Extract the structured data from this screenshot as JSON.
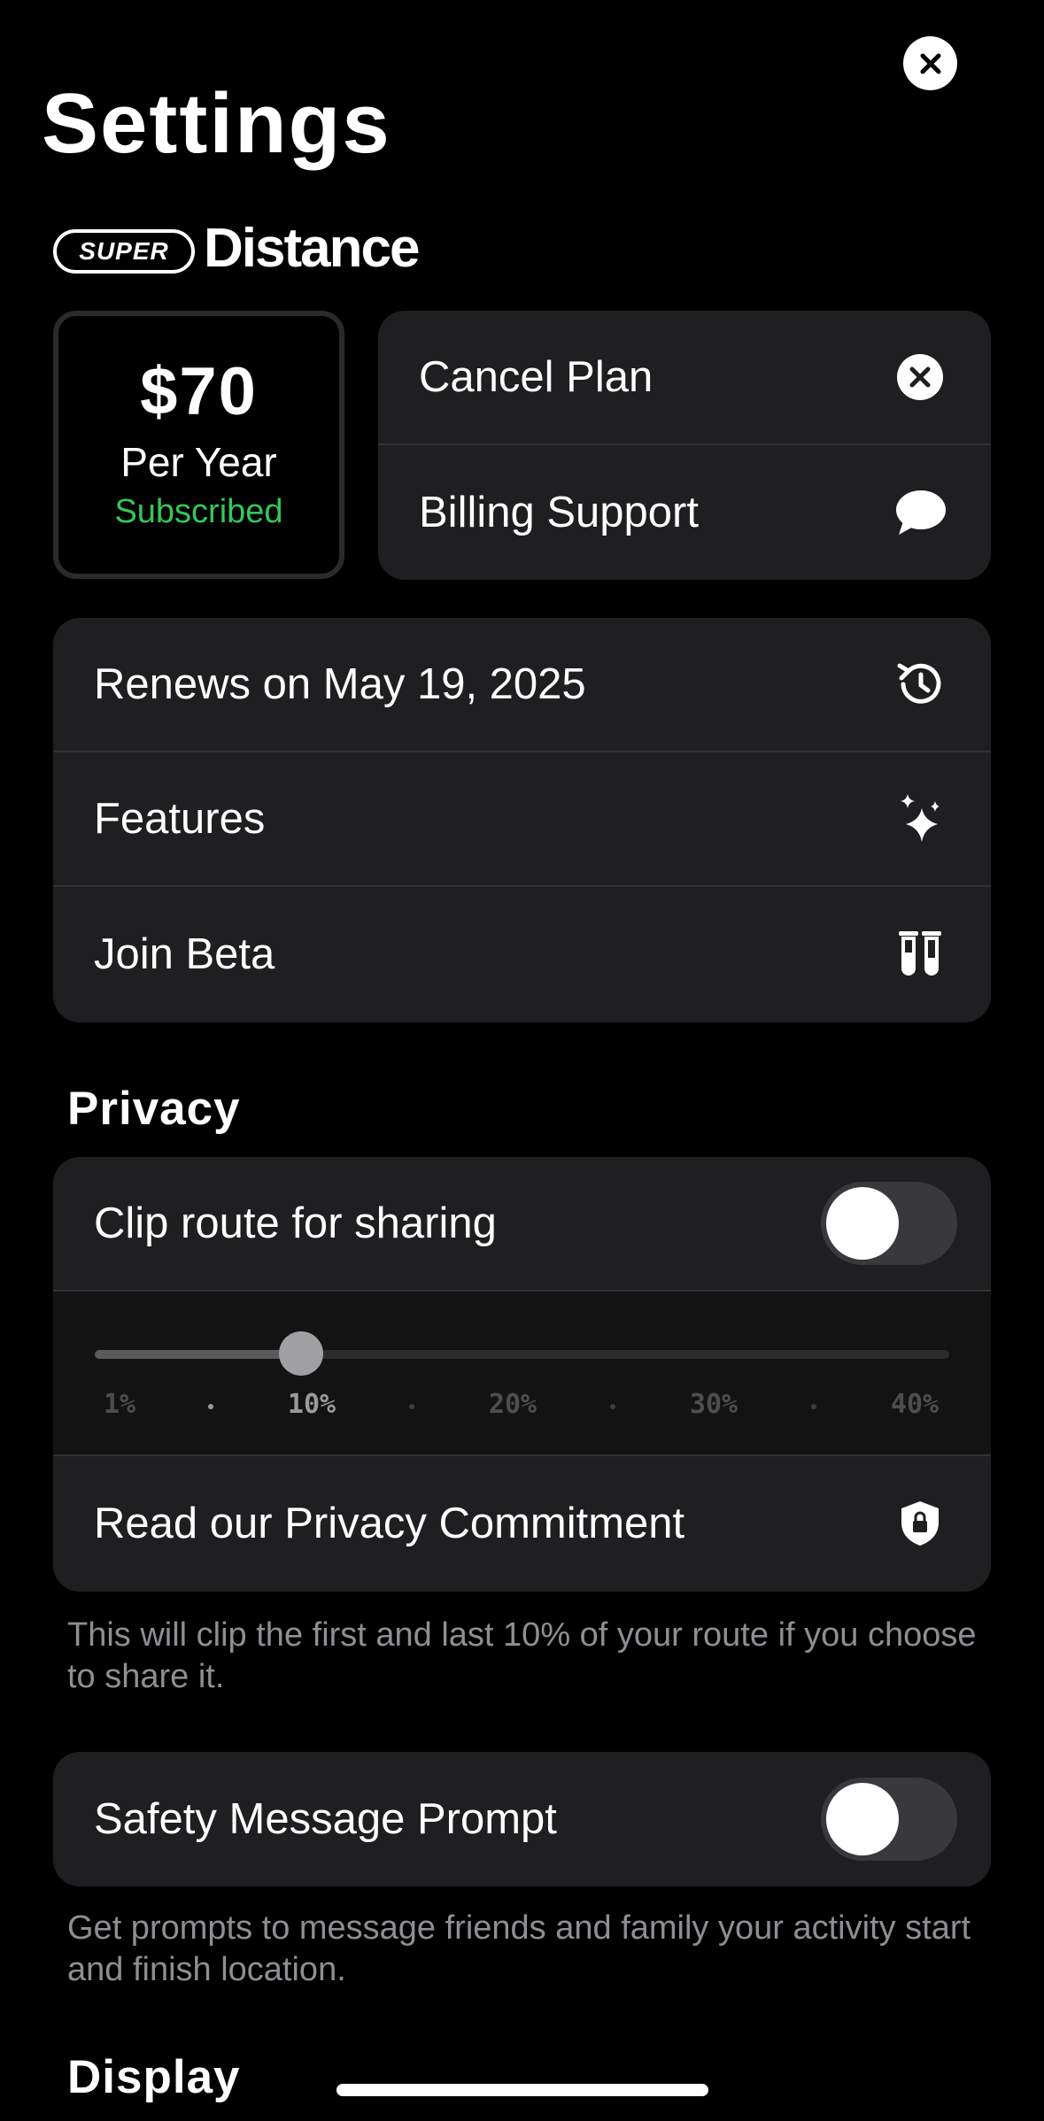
{
  "header": {
    "title": "Settings",
    "close_icon": "close-icon"
  },
  "brand": {
    "badge": "SUPER",
    "name": "Distance"
  },
  "plan": {
    "price": "$70",
    "period": "Per Year",
    "status": "Subscribed",
    "status_color": "#34c759"
  },
  "plan_actions": [
    {
      "label": "Cancel Plan",
      "icon": "close-circle-icon"
    },
    {
      "label": "Billing Support",
      "icon": "chat-bubble-icon"
    }
  ],
  "subscription": [
    {
      "label": "Renews on May 19, 2025",
      "icon": "history-icon"
    },
    {
      "label": "Features",
      "icon": "sparkles-icon"
    },
    {
      "label": "Join Beta",
      "icon": "test-tubes-icon"
    }
  ],
  "privacy": {
    "title": "Privacy",
    "clip_label": "Clip route for sharing",
    "clip_enabled": false,
    "slider": {
      "ticks": [
        "1%",
        "10%",
        "20%",
        "30%",
        "40%"
      ],
      "value": "10%"
    },
    "commitment_label": "Read our Privacy Commitment",
    "commitment_icon": "shield-lock-icon",
    "note": "This will clip the first and last 10% of your route if you choose to share it."
  },
  "safety": {
    "label": "Safety Message Prompt",
    "enabled": false,
    "note": "Get prompts to message friends and family your activity start and finish location."
  },
  "display": {
    "title": "Display"
  }
}
